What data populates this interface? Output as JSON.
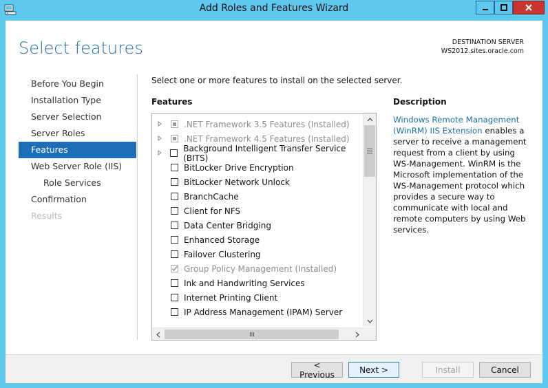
{
  "window": {
    "title": "Add Roles and Features Wizard",
    "close_glyph": "✕",
    "minimize_glyph": "▁",
    "maximize_glyph": "□"
  },
  "header": {
    "page_title": "Select features",
    "destination_label": "DESTINATION SERVER",
    "destination_server": "WS2012.sites.oracle.com"
  },
  "nav": {
    "items": [
      {
        "label": "Before You Begin",
        "state": "normal"
      },
      {
        "label": "Installation Type",
        "state": "normal"
      },
      {
        "label": "Server Selection",
        "state": "normal"
      },
      {
        "label": "Server Roles",
        "state": "normal"
      },
      {
        "label": "Features",
        "state": "active"
      },
      {
        "label": "Web Server Role (IIS)",
        "state": "normal"
      },
      {
        "label": "Role Services",
        "state": "sub"
      },
      {
        "label": "Confirmation",
        "state": "normal"
      },
      {
        "label": "Results",
        "state": "disabled"
      }
    ]
  },
  "main": {
    "instruction": "Select one or more features to install on the selected server.",
    "features_heading": "Features",
    "features": [
      {
        "label": ".NET Framework 3.5 Features (Installed)",
        "expandable": true,
        "state": "partial-installed"
      },
      {
        "label": ".NET Framework 4.5 Features (Installed)",
        "expandable": true,
        "state": "partial-installed"
      },
      {
        "label": "Background Intelligent Transfer Service (BITS)",
        "expandable": true,
        "state": "unchecked"
      },
      {
        "label": "BitLocker Drive Encryption",
        "expandable": false,
        "state": "unchecked"
      },
      {
        "label": "BitLocker Network Unlock",
        "expandable": false,
        "state": "unchecked"
      },
      {
        "label": "BranchCache",
        "expandable": false,
        "state": "unchecked"
      },
      {
        "label": "Client for NFS",
        "expandable": false,
        "state": "unchecked"
      },
      {
        "label": "Data Center Bridging",
        "expandable": false,
        "state": "unchecked"
      },
      {
        "label": "Enhanced Storage",
        "expandable": false,
        "state": "unchecked"
      },
      {
        "label": "Failover Clustering",
        "expandable": false,
        "state": "unchecked"
      },
      {
        "label": "Group Policy Management (Installed)",
        "expandable": false,
        "state": "checked-installed"
      },
      {
        "label": "Ink and Handwriting Services",
        "expandable": false,
        "state": "unchecked"
      },
      {
        "label": "Internet Printing Client",
        "expandable": false,
        "state": "unchecked"
      },
      {
        "label": "IP Address Management (IPAM) Server",
        "expandable": false,
        "state": "unchecked"
      }
    ]
  },
  "description": {
    "heading": "Description",
    "link_text": "Windows Remote Management (WinRM) IIS Extension",
    "body": " enables a server to receive a management request from a client by using WS-Management. WinRM is the Microsoft implementation of the WS-Management protocol which provides a secure way to communicate with local and remote computers by using Web services."
  },
  "footer": {
    "previous_label": "< Previous",
    "next_label": "Next >",
    "install_label": "Install",
    "cancel_label": "Cancel"
  },
  "colors": {
    "title_bar": "#5ec8ee",
    "accent": "#1b6ea8",
    "nav_active": "#1c6fb6",
    "close_button": "#c7372f"
  }
}
